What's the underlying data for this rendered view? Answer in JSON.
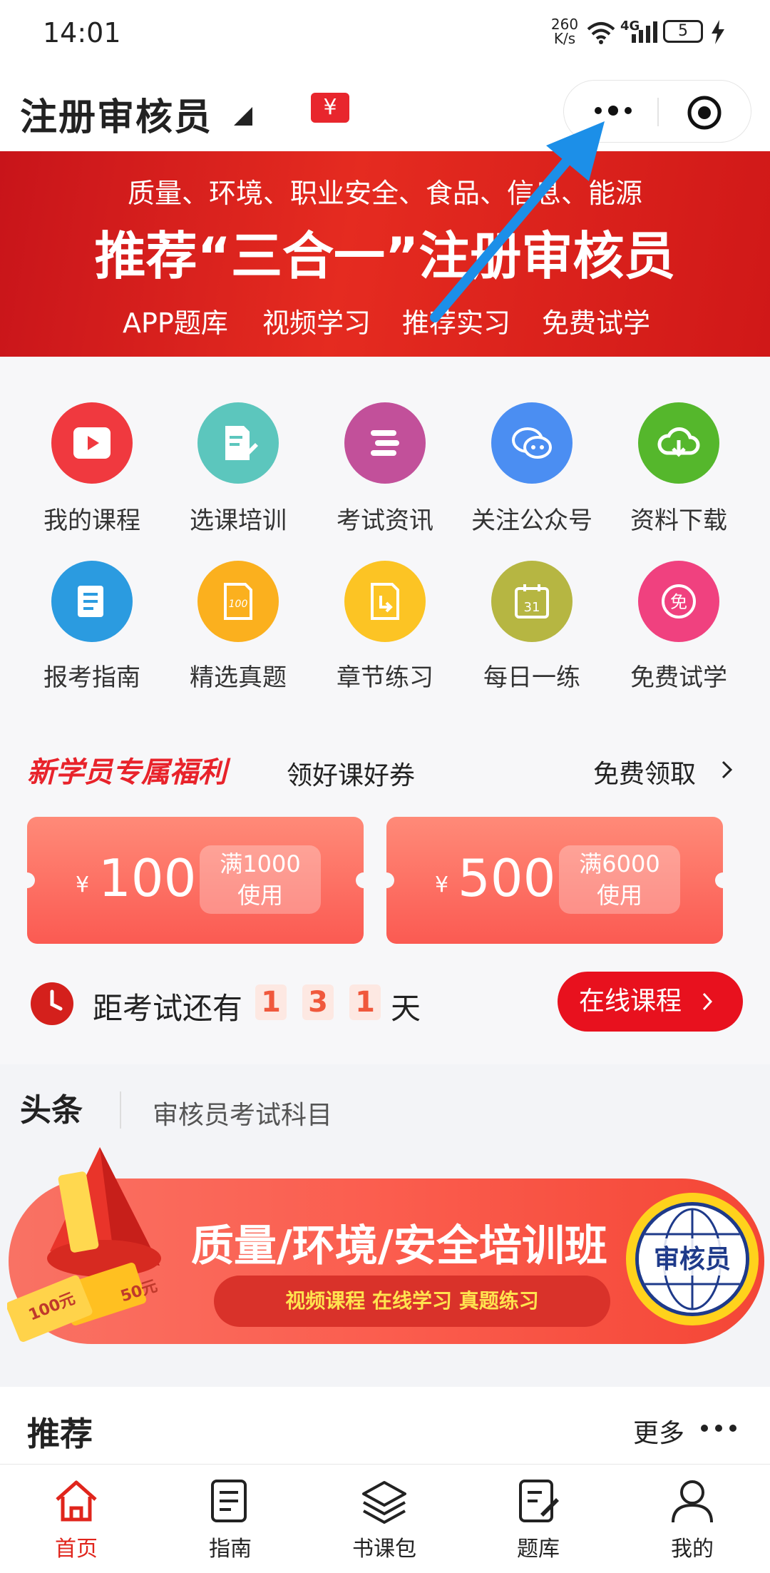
{
  "status": {
    "time": "14:01",
    "speed_value": "260",
    "speed_unit": "K/s",
    "network": "4G",
    "battery": "5"
  },
  "header": {
    "title": "注册审核员"
  },
  "banner": {
    "line1": "质量、环境、职业安全、食品、信息、能源",
    "headline": "推荐“三合一”注册审核员",
    "features": [
      "APP题库",
      "视频学习",
      "推荐实习",
      "免费试学"
    ]
  },
  "grid": [
    {
      "label": "我的课程",
      "icon": "play-icon",
      "color": "#f0393f"
    },
    {
      "label": "选课培训",
      "icon": "document-edit-icon",
      "color": "#5cc6bd"
    },
    {
      "label": "考试资讯",
      "icon": "message-lines-icon",
      "color": "#c2509a"
    },
    {
      "label": "关注公众号",
      "icon": "wechat-icon",
      "color": "#4b8ef2"
    },
    {
      "label": "资料下载",
      "icon": "cloud-download-icon",
      "color": "#55b72c"
    },
    {
      "label": "报考指南",
      "icon": "guide-doc-icon",
      "color": "#2b9be0"
    },
    {
      "label": "精选真题",
      "icon": "exam-paper-icon",
      "color": "#fbb01e"
    },
    {
      "label": "章节练习",
      "icon": "chapter-file-icon",
      "color": "#fcc424"
    },
    {
      "label": "每日一练",
      "icon": "calendar-icon",
      "color": "#b6b642"
    },
    {
      "label": "免费试学",
      "icon": "free-badge-icon",
      "color": "#f0417f"
    }
  ],
  "promo": {
    "title": "新学员专属福利",
    "subtitle": "领好课好券",
    "action": "免费领取"
  },
  "coupons": [
    {
      "currency": "¥",
      "amount": "100",
      "condition1": "满1000",
      "condition2": "使用"
    },
    {
      "currency": "¥",
      "amount": "500",
      "condition1": "满6000",
      "condition2": "使用"
    }
  ],
  "countdown": {
    "prefix": "距考试还有",
    "digits": [
      "1",
      "3",
      "1"
    ],
    "suffix": "天",
    "button": "在线课程"
  },
  "headline_news": {
    "label": "头条",
    "text": "审核员考试科目"
  },
  "ad": {
    "title": "质量/环境/安全培训班",
    "features": "视频课程  在线学习  真题练习",
    "badge": "审核员",
    "coupon1": "100元",
    "coupon2": "50元"
  },
  "recommend": {
    "title": "推荐",
    "more": "更多"
  },
  "tabs": [
    {
      "label": "首页",
      "icon": "home-icon",
      "active": true
    },
    {
      "label": "指南",
      "icon": "guide-icon",
      "active": false
    },
    {
      "label": "书课包",
      "icon": "layers-icon",
      "active": false
    },
    {
      "label": "题库",
      "icon": "question-bank-icon",
      "active": false
    },
    {
      "label": "我的",
      "icon": "user-icon",
      "active": false
    }
  ],
  "colors": {
    "brand_red": "#e0251c",
    "active_tab": "#e0251c",
    "arrow": "#1c8fe8"
  }
}
